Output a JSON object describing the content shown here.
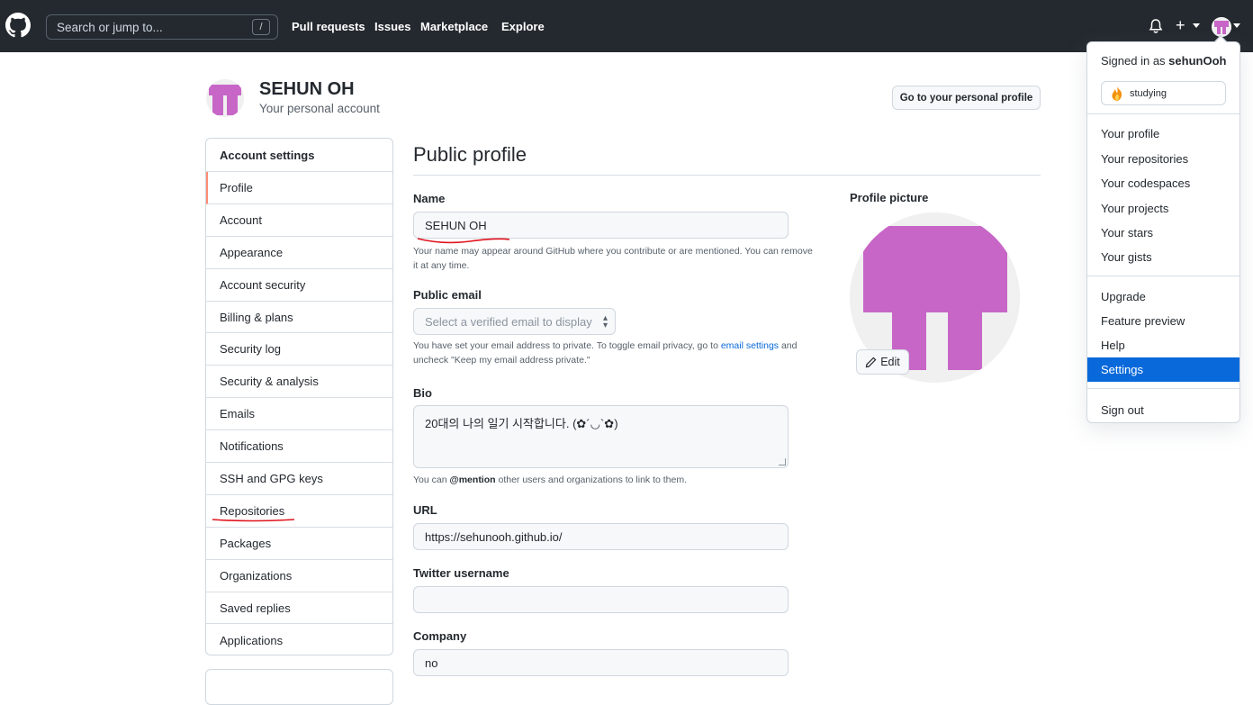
{
  "header": {
    "search_placeholder": "Search or jump to...",
    "search_shortcut": "/",
    "nav": [
      "Pull requests",
      "Issues",
      "Marketplace",
      "Explore"
    ]
  },
  "account": {
    "name": "SEHUN OH",
    "subtitle": "Your personal account",
    "go_button": "Go to your personal profile"
  },
  "sidebar": {
    "heading": "Account settings",
    "items": [
      {
        "label": "Profile"
      },
      {
        "label": "Account"
      },
      {
        "label": "Appearance"
      },
      {
        "label": "Account security"
      },
      {
        "label": "Billing & plans"
      },
      {
        "label": "Security log"
      },
      {
        "label": "Security & analysis"
      },
      {
        "label": "Emails"
      },
      {
        "label": "Notifications"
      },
      {
        "label": "SSH and GPG keys"
      },
      {
        "label": "Repositories"
      },
      {
        "label": "Packages"
      },
      {
        "label": "Organizations"
      },
      {
        "label": "Saved replies"
      },
      {
        "label": "Applications"
      }
    ]
  },
  "main": {
    "title": "Public profile",
    "name_label": "Name",
    "name_value": "SEHUN OH",
    "name_note": "Your name may appear around GitHub where you contribute or are mentioned. You can remove it at any time.",
    "email_label": "Public email",
    "email_placeholder": "Select a verified email to display",
    "email_note_a": "You have set your email address to private. To toggle email privacy, go to ",
    "email_note_link": "email settings",
    "email_note_b": " and uncheck \"Keep my email address private.\"",
    "bio_label": "Bio",
    "bio_value": "20대의 나의 일기 시작합니다. (✿´◡`✿)",
    "bio_note_a": "You can ",
    "bio_note_bold": "@mention",
    "bio_note_b": " other users and organizations to link to them.",
    "url_label": "URL",
    "url_value": "https://sehunooh.github.io/",
    "twitter_label": "Twitter username",
    "twitter_value": "",
    "company_label": "Company",
    "company_value": "no",
    "picture_label": "Profile picture",
    "edit_label": "Edit"
  },
  "dropdown": {
    "signed_prefix": "Signed in as ",
    "username": "sehunOoh",
    "status": "studying",
    "group1": [
      "Your profile",
      "Your repositories",
      "Your codespaces",
      "Your projects",
      "Your stars",
      "Your gists"
    ],
    "group2": [
      "Upgrade",
      "Feature preview",
      "Help",
      "Settings"
    ],
    "sign_out": "Sign out",
    "active_item": "Settings"
  },
  "colors": {
    "header_bg": "#24292f",
    "avatar_pink": "#c766c7",
    "active_blue": "#0969da",
    "active_sidebar_border": "#fd8c73",
    "annotation_red": "#e0141e"
  },
  "icons": [
    "github-logo-icon",
    "bell-icon",
    "plus-icon",
    "chevron-down-icon",
    "pencil-icon",
    "fire-emoji-icon"
  ]
}
